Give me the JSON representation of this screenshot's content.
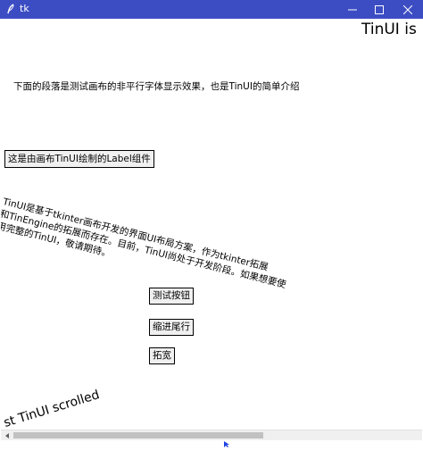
{
  "window": {
    "title": "tk",
    "icon": "feather-icon",
    "controls": [
      "minimize-icon",
      "maximize-icon",
      "close-icon"
    ]
  },
  "canvas": {
    "heading_large": "TinUI is",
    "intro_text": "下面的段落是测试画布的非平行字体显示效果，也是TinUI的简单介绍",
    "label_widget_text": "这是由画布TinUI绘制的Label组件",
    "slanted_paragraph": [
      "TinUI是基于tkinter画布开发的界面UI布局方案，作为tkinter拓展",
      "和TinEngine的拓展而存在。目前，TinUI尚处于开发阶段。如果想要使",
      "用完整的TinUI，敬请期待。"
    ],
    "buttons": {
      "test": "测试按钮",
      "indent": "缩进尾行",
      "expand": "拓宽"
    },
    "scrolled_text": "st TinUI scrolled"
  },
  "colors": {
    "titlebar": "#3c4dc4",
    "titlebar_text": "#ffffff",
    "button_bg": "#f0f0f0",
    "scroll_thumb": "#c1c1c1"
  }
}
